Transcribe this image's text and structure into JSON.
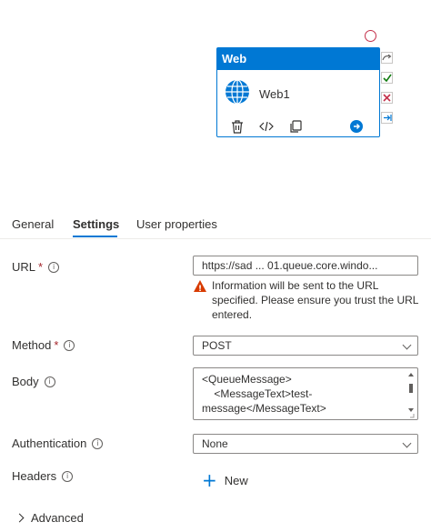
{
  "activity": {
    "type_label": "Web",
    "name": "Web1"
  },
  "tabs": [
    {
      "label": "General"
    },
    {
      "label": "Settings"
    },
    {
      "label": "User properties"
    }
  ],
  "form": {
    "url": {
      "label": "URL",
      "required_mark": "*",
      "value": "https://sad         ... 01.queue.core.windo...",
      "warning": "Information will be sent to the URL specified. Please ensure you trust the URL entered."
    },
    "method": {
      "label": "Method",
      "required_mark": "*",
      "value": "POST"
    },
    "body": {
      "label": "Body",
      "lines": [
        "<QueueMessage>",
        "    <MessageText>test-",
        "message</MessageText>"
      ]
    },
    "authentication": {
      "label": "Authentication",
      "value": "None"
    },
    "headers": {
      "label": "Headers",
      "new_label": "New"
    },
    "advanced": {
      "label": "Advanced"
    }
  },
  "colors": {
    "accent": "#0078d4",
    "warning": "#d83b01",
    "delete": "#c4314b",
    "success": "#107c10"
  }
}
